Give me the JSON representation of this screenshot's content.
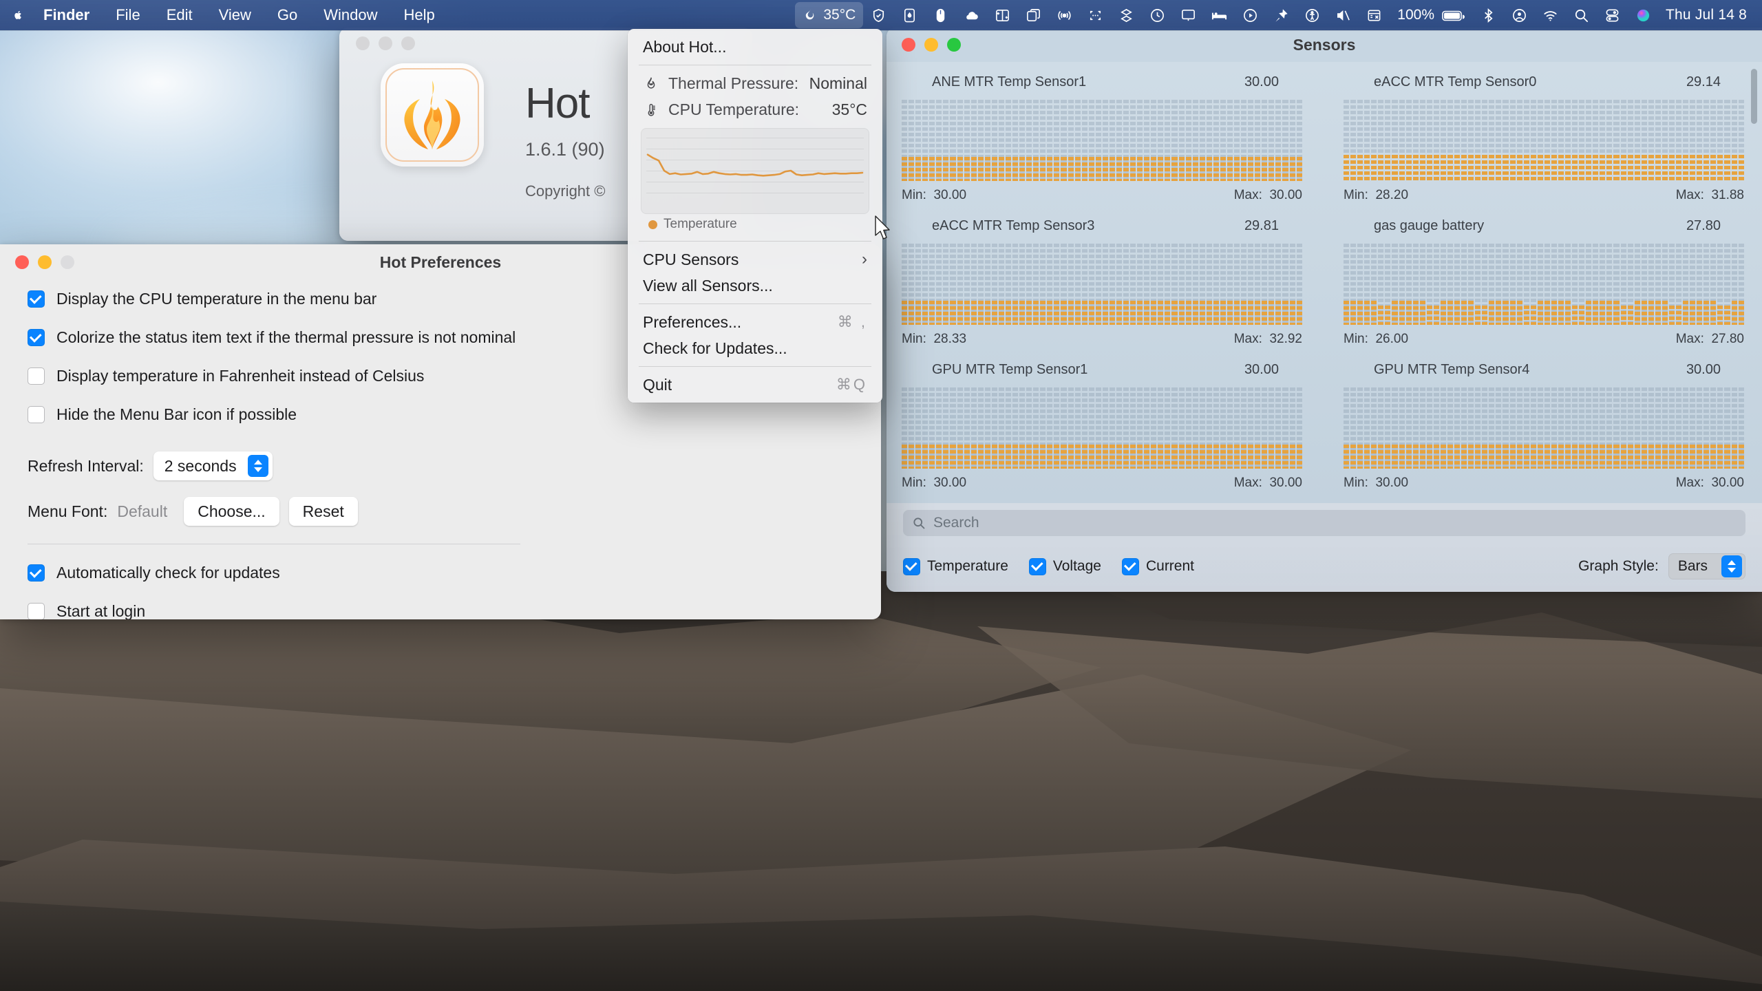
{
  "menubar": {
    "apple_icon": "apple-logo-icon",
    "items": [
      "Finder",
      "File",
      "Edit",
      "View",
      "Go",
      "Window",
      "Help"
    ],
    "status_items": [
      {
        "icon": "flame-icon",
        "label": "35°C",
        "active": true
      },
      {
        "icon": "shield-check-icon",
        "label": ""
      },
      {
        "icon": "droplet-square-icon",
        "label": ""
      },
      {
        "icon": "mouse-icon",
        "label": ""
      },
      {
        "icon": "cloud-icon",
        "label": ""
      },
      {
        "icon": "window-split-icon",
        "label": ""
      },
      {
        "icon": "copy-windows-icon",
        "label": ""
      },
      {
        "icon": "airplay-broadcast-icon",
        "label": ""
      },
      {
        "icon": "dots-brackets-icon",
        "label": ""
      },
      {
        "icon": "layers-icon",
        "label": ""
      },
      {
        "icon": "time-machine-icon",
        "label": ""
      },
      {
        "icon": "display-icon",
        "label": ""
      },
      {
        "icon": "bed-icon",
        "label": ""
      },
      {
        "icon": "play-circle-icon",
        "label": ""
      },
      {
        "icon": "pin-text-icon",
        "label": ""
      },
      {
        "icon": "accessibility-icon",
        "label": ""
      },
      {
        "icon": "speaker-mute-icon",
        "label": ""
      },
      {
        "icon": "calendar-x-icon",
        "label": ""
      }
    ],
    "battery_percent": "100%",
    "battery_icon": "battery-full-icon",
    "right_icons": [
      {
        "icon": "bluetooth-icon"
      },
      {
        "icon": "user-circle-icon"
      },
      {
        "icon": "wifi-icon"
      },
      {
        "icon": "search-icon"
      },
      {
        "icon": "control-center-icon"
      },
      {
        "icon": "siri-icon"
      }
    ],
    "clock": "Thu Jul 14  8"
  },
  "about_window": {
    "app_name": "Hot",
    "version": "1.6.1 (90)",
    "copyright": "Copyright ©",
    "app_icon": "flame-app-icon"
  },
  "hot_menu": {
    "about_label": "About Hot...",
    "thermal_pressure_label": "Thermal Pressure:",
    "thermal_pressure_value": "Nominal",
    "thermal_pressure_icon": "flame-outline-icon",
    "cpu_temperature_label": "CPU Temperature:",
    "cpu_temperature_value": "35°C",
    "cpu_temperature_icon": "thermometer-icon",
    "legend_label": "Temperature",
    "legend_color": "#e0973f",
    "cpu_sensors_label": "CPU Sensors",
    "cpu_sensors_chevron": "chevron-right-icon",
    "view_all_sensors_label": "View all Sensors...",
    "preferences_label": "Preferences...",
    "preferences_shortcut": "⌘ ,",
    "check_updates_label": "Check for Updates...",
    "quit_label": "Quit",
    "quit_shortcut": "⌘Q"
  },
  "chart_data": {
    "type": "line",
    "title": "",
    "xlabel": "",
    "ylabel": "",
    "legend": [
      "Temperature"
    ],
    "legend_position": "bottom-left",
    "grid": true,
    "ylim": [
      30,
      45
    ],
    "series": [
      {
        "name": "Temperature",
        "color": "#e0973f",
        "values": [
          40,
          39.2,
          38.6,
          36.2,
          35.4,
          35.6,
          35.3,
          35.4,
          35.5,
          35.9,
          35.4,
          35.5,
          35.9,
          35.6,
          35.4,
          35.3,
          35.4,
          35.2,
          35.2,
          35.3,
          35.1,
          35.0,
          35.1,
          35.2,
          35.4,
          36.0,
          36.2,
          35.3,
          35.1,
          35.2,
          35.3,
          35.6,
          35.4,
          35.5,
          35.6,
          35.5,
          35.5,
          35.6,
          35.6,
          35.7
        ]
      }
    ]
  },
  "preferences_window": {
    "title": "Hot Preferences",
    "checkboxes": [
      {
        "label": "Display the CPU temperature in the menu bar",
        "checked": true
      },
      {
        "label": "Colorize the status item text if the thermal pressure is not nominal",
        "checked": true
      },
      {
        "label": "Display temperature in Fahrenheit instead of Celsius",
        "checked": false
      },
      {
        "label": "Hide the Menu Bar icon if possible",
        "checked": false
      }
    ],
    "refresh_interval_label": "Refresh Interval:",
    "refresh_interval_value": "2 seconds",
    "menu_font_label": "Menu Font:",
    "menu_font_value": "Default",
    "choose_button": "Choose...",
    "reset_button": "Reset",
    "bottom_checkboxes": [
      {
        "label": "Automatically check for updates",
        "checked": true
      },
      {
        "label": "Start at login",
        "checked": false
      }
    ]
  },
  "sensors_window": {
    "title": "Sensors",
    "search_placeholder": "Search",
    "search_icon": "search-icon",
    "search_value": "",
    "min_label": "Min:",
    "max_label": "Max:",
    "filters": [
      {
        "label": "Temperature",
        "checked": true
      },
      {
        "label": "Voltage",
        "checked": true
      },
      {
        "label": "Current",
        "checked": true
      }
    ],
    "graph_style_label": "Graph Style:",
    "graph_style_value": "Bars",
    "bar_color": "#e7a33e",
    "sensors": [
      {
        "name": "ANE MTR Temp Sensor1",
        "value": "30.00",
        "min": "30.00",
        "max": "30.00",
        "fill": 0.3,
        "gaps": false
      },
      {
        "name": "eACC MTR Temp Sensor0",
        "value": "29.14",
        "min": "28.20",
        "max": "31.88",
        "fill": 0.32,
        "gaps": false
      },
      {
        "name": "eACC MTR Temp Sensor3",
        "value": "29.81",
        "min": "28.33",
        "max": "32.92",
        "fill": 0.3,
        "gaps": false
      },
      {
        "name": "gas gauge battery",
        "value": "27.80",
        "min": "26.00",
        "max": "27.80",
        "fill": 0.3,
        "gaps": true
      },
      {
        "name": "GPU MTR Temp Sensor1",
        "value": "30.00",
        "min": "30.00",
        "max": "30.00",
        "fill": 0.3,
        "gaps": false
      },
      {
        "name": "GPU MTR Temp Sensor4",
        "value": "30.00",
        "min": "30.00",
        "max": "30.00",
        "fill": 0.3,
        "gaps": false
      }
    ]
  }
}
